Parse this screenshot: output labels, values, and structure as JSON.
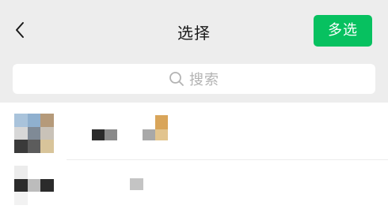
{
  "header": {
    "back_icon": "chevron-left-icon",
    "title": "选择",
    "multi_select_label": "多选",
    "accent": "#07c160"
  },
  "search": {
    "icon": "search-icon",
    "placeholder": "搜索"
  },
  "chats": [
    {
      "avatar": "blurred-group-avatar",
      "name": "",
      "preview": ""
    },
    {
      "avatar": "blurred-group-avatar",
      "name": "",
      "preview": ""
    }
  ]
}
